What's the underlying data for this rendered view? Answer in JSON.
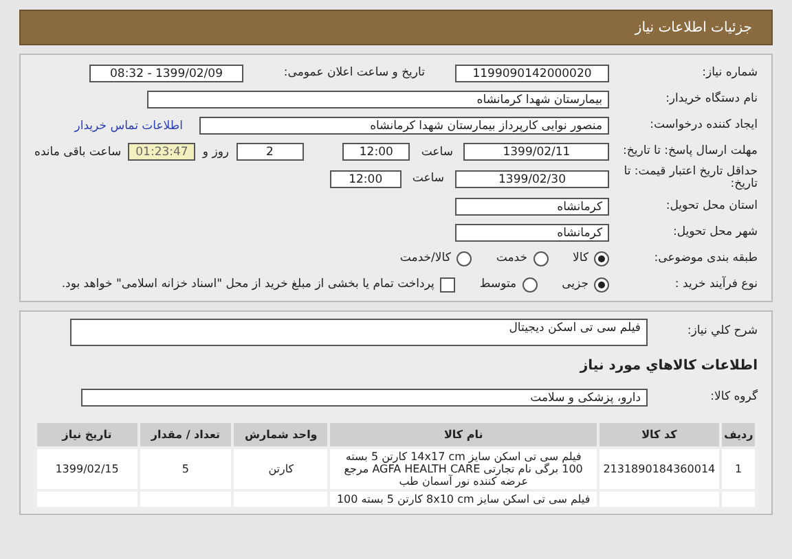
{
  "header": {
    "title": "جزئیات اطلاعات نیاز"
  },
  "details": {
    "need_number": {
      "label": "شماره نیاز:",
      "value": "1199090142000020"
    },
    "announce": {
      "label": "تاریخ و ساعت اعلان عمومی:",
      "value": "1399/02/09 - 08:32"
    },
    "buyer": {
      "label": "نام دستگاه خریدار:",
      "value": "بیمارستان شهدا کرمانشاه"
    },
    "creator": {
      "label": "ایجاد کننده درخواست:",
      "value": "منصور نوایی کارپرداز بیمارستان شهدا کرمانشاه",
      "link": "اطلاعات تماس خریدار"
    },
    "deadline": {
      "label": "مهلت ارسال پاسخ: تا تاریخ:",
      "date": "1399/02/11",
      "time_label": "ساعت",
      "time": "12:00",
      "days": "2",
      "days_label": "روز و",
      "remaining": "01:23:47",
      "remaining_label": "ساعت باقی مانده"
    },
    "validity": {
      "label": "حداقل تاریخ اعتبار قیمت: تا تاریخ:",
      "date": "1399/02/30",
      "time_label": "ساعت",
      "time": "12:00"
    },
    "province": {
      "label": "استان محل تحویل:",
      "value": "کرمانشاه"
    },
    "city": {
      "label": "شهر محل تحویل:",
      "value": "کرمانشاه"
    },
    "category": {
      "label": "طبقه بندی موضوعی:",
      "options": [
        {
          "label": "کالا",
          "selected": true
        },
        {
          "label": "خدمت",
          "selected": false
        },
        {
          "label": "کالا/خدمت",
          "selected": false
        }
      ]
    },
    "process": {
      "label": "نوع فرآیند خرید :",
      "options": [
        {
          "label": "جزیی",
          "selected": true
        },
        {
          "label": "متوسط",
          "selected": false
        }
      ],
      "treasury": {
        "label": "پرداخت تمام یا بخشی از مبلغ خرید از محل \"اسناد خزانه اسلامی\" خواهد بود.",
        "checked": false
      }
    }
  },
  "need": {
    "description_label": "شرح کلي نياز:",
    "description": "فیلم سی تی اسکن دیجیتال",
    "goods_title": "اطلاعات کالاهاي مورد نياز",
    "group_label": "گروه کالا:",
    "group": "دارو، پزشکی و سلامت"
  },
  "table": {
    "columns": [
      "ردیف",
      "کد کالا",
      "نام کالا",
      "واحد شمارش",
      "تعداد / مقدار",
      "تاریخ نیاز"
    ],
    "rows": [
      [
        "1",
        "2131890184360014",
        "فیلم سی تی اسکن سایز 14x17 cm کارتن 5 بسته 100 برگی نام تجارتی AGFA HEALTH CARE مرجع عرضه کننده نور آسمان طب",
        "کارتن",
        "5",
        "1399/02/15"
      ],
      [
        "",
        "",
        "فیلم سی تی اسکن سایز 8x10 cm کارتن 5 بسته 100",
        "",
        "",
        ""
      ]
    ]
  }
}
